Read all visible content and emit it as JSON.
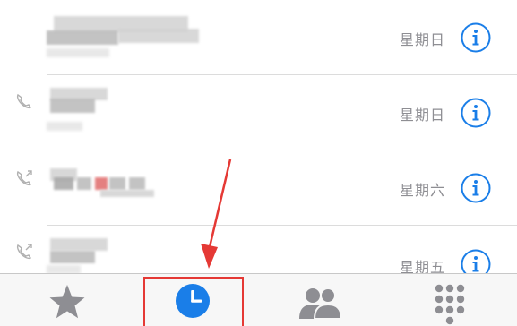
{
  "recents": {
    "calls": [
      {
        "day": "星期日",
        "direction": "none"
      },
      {
        "day": "星期日",
        "direction": "incoming"
      },
      {
        "day": "星期六",
        "direction": "outgoing"
      },
      {
        "day": "星期五",
        "direction": "outgoing"
      }
    ]
  },
  "tab_bar": {
    "tabs": [
      {
        "icon": "star-icon",
        "active": false
      },
      {
        "icon": "clock-icon",
        "active": true
      },
      {
        "icon": "contacts-icon",
        "active": false
      },
      {
        "icon": "keypad-icon",
        "active": false
      }
    ]
  },
  "colors": {
    "accent": "#1a7ee8",
    "tab_inactive": "#8e8e93",
    "annotation_red": "#e53935",
    "day_text": "#8e8e93"
  }
}
